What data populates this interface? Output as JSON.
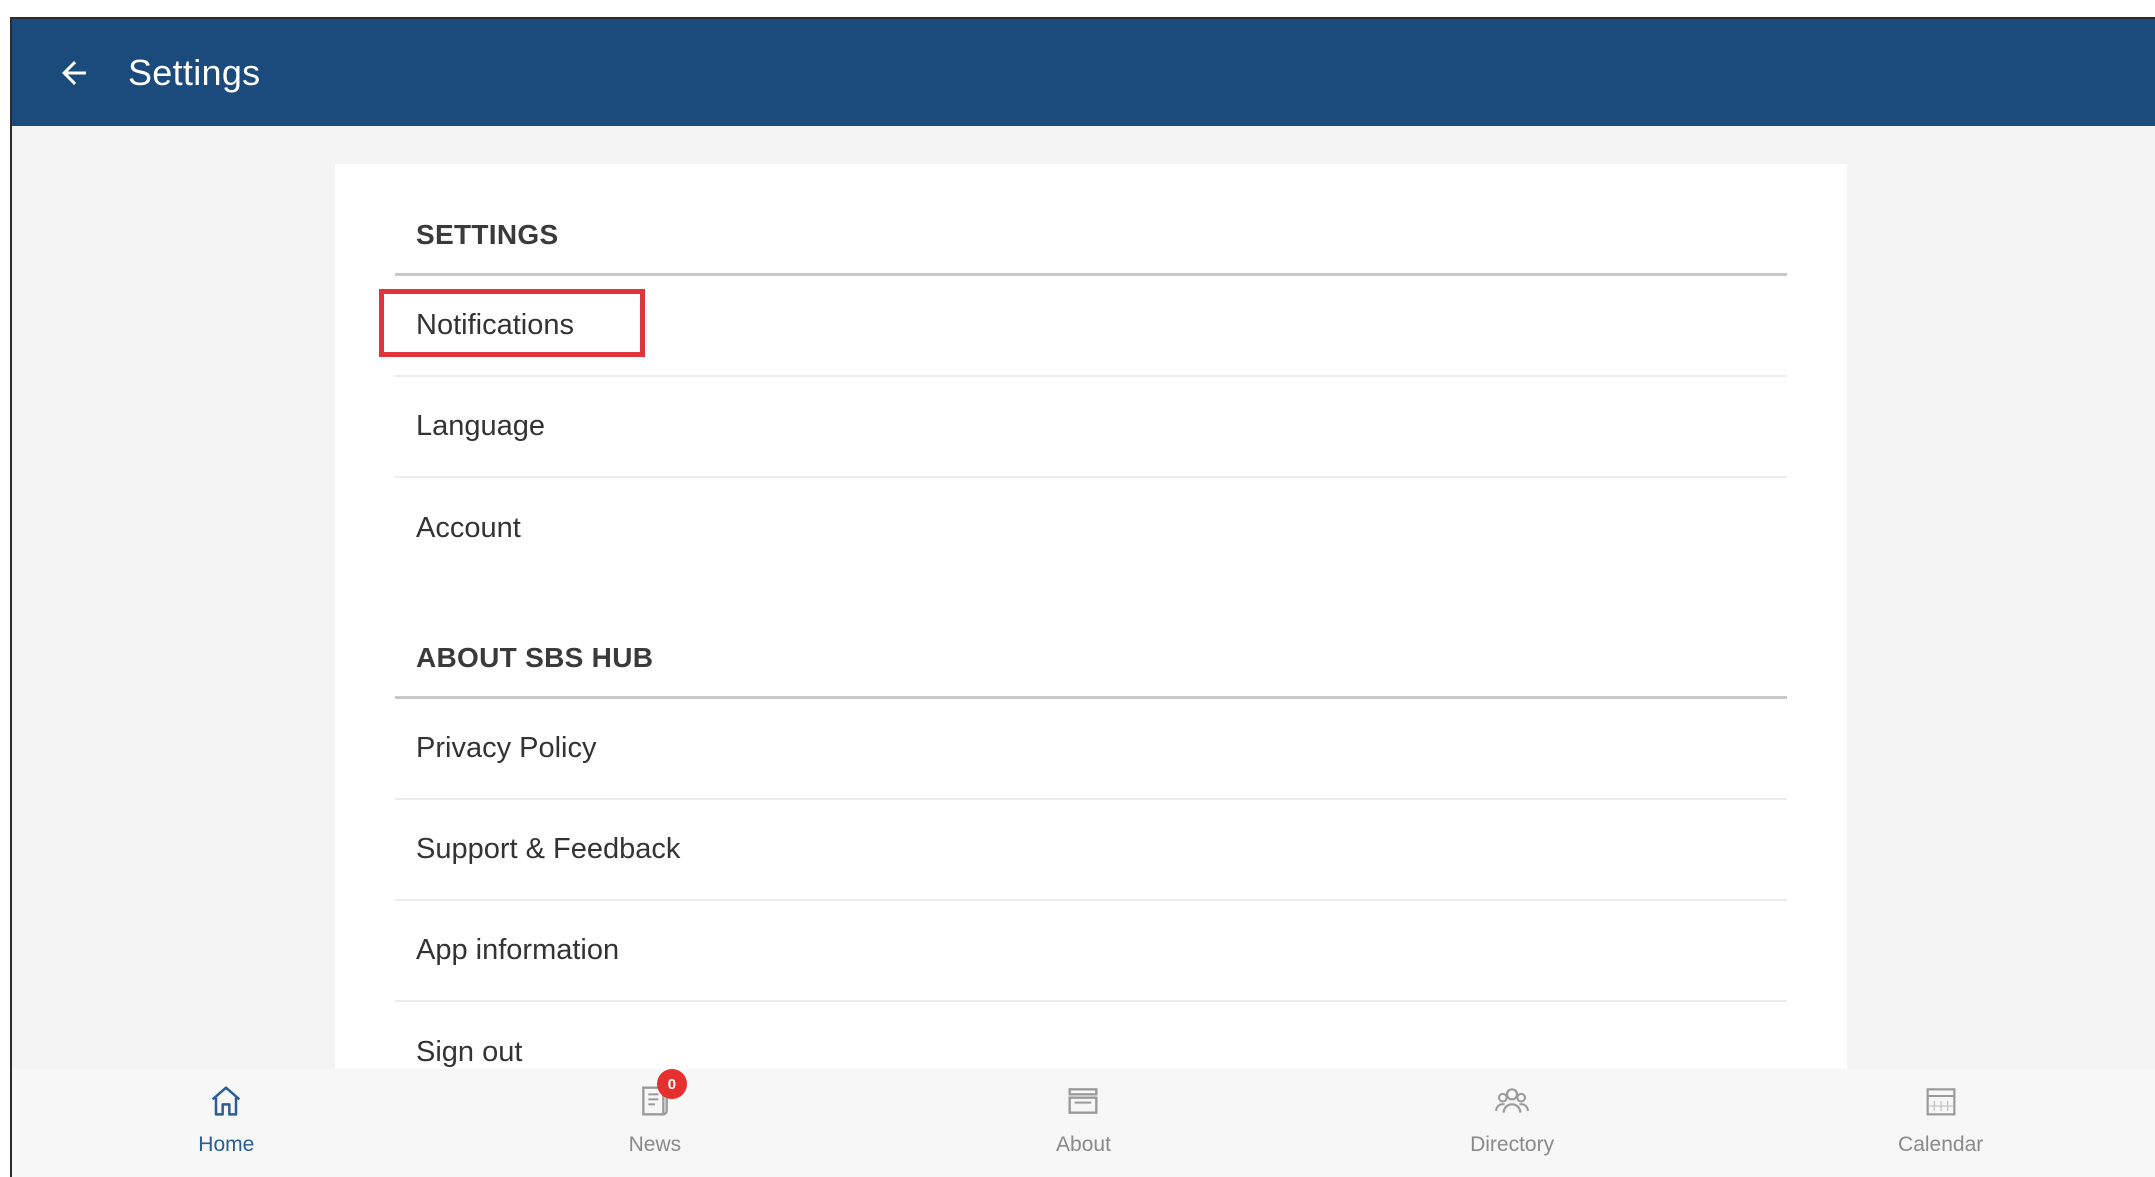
{
  "app_bar": {
    "title": "Settings",
    "background": "#1a4b7c",
    "back_icon": "arrow-left-icon"
  },
  "settings_section": {
    "header": "SETTINGS",
    "items": [
      {
        "label": "Notifications",
        "highlighted": true
      },
      {
        "label": "Language"
      },
      {
        "label": "Account"
      }
    ]
  },
  "about_section": {
    "header": "ABOUT SBS HUB",
    "items": [
      {
        "label": "Privacy Policy"
      },
      {
        "label": "Support & Feedback"
      },
      {
        "label": "App information"
      },
      {
        "label": "Sign out"
      }
    ]
  },
  "highlight_color": "#e2353b",
  "bottom_nav": {
    "active_color": "#2a5d94",
    "items": [
      {
        "label": "Home",
        "icon": "home-icon",
        "active": true
      },
      {
        "label": "News",
        "icon": "news-icon",
        "badge": "0"
      },
      {
        "label": "About",
        "icon": "about-icon"
      },
      {
        "label": "Directory",
        "icon": "directory-icon"
      },
      {
        "label": "Calendar",
        "icon": "calendar-icon"
      }
    ]
  }
}
